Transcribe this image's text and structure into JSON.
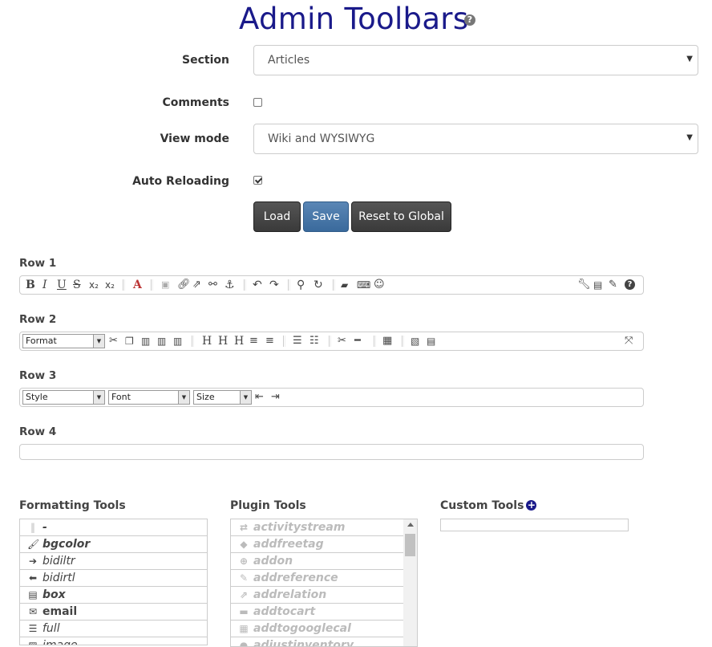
{
  "page": {
    "title": "Admin Toolbars",
    "help_glyph": "?"
  },
  "form": {
    "section_label": "Section",
    "section_value": "Articles",
    "comments_label": "Comments",
    "comments_checked": false,
    "view_mode_label": "View mode",
    "view_mode_value": "Wiki and WYSIWYG",
    "auto_reloading_label": "Auto Reloading",
    "auto_reloading_checked": true
  },
  "buttons": {
    "load": "Load",
    "save": "Save",
    "reset": "Reset to Global"
  },
  "rows": {
    "row1": "Row 1",
    "row2": "Row 2",
    "row3": "Row 3",
    "row4": "Row 4"
  },
  "row1_tools": [
    "bold-icon",
    "italic-icon",
    "underline-icon",
    "strike-icon",
    "subscript-icon",
    "superscript-icon",
    "color-icon",
    "image-icon",
    "link-icon",
    "external-link-icon",
    "unlink-icon",
    "anchor-icon",
    "undo-icon",
    "redo-icon",
    "find-icon",
    "replace-icon",
    "eraser-icon",
    "keyboard-icon",
    "smiley-icon",
    "wrench-icon",
    "save-icon",
    "pencil-icon",
    "help-icon"
  ],
  "row2": {
    "format_combo": "Format"
  },
  "row3": {
    "style_combo": "Style",
    "font_combo": "Font",
    "size_combo": "Size"
  },
  "sections": {
    "formatting": "Formatting Tools",
    "plugin": "Plugin Tools",
    "custom": "Custom Tools"
  },
  "formatting_tools": [
    {
      "name": "-",
      "icon": "separator-icon"
    },
    {
      "name": "bgcolor",
      "icon": "brush-icon"
    },
    {
      "name": "bidiltr",
      "icon": "arrow-right-icon"
    },
    {
      "name": "bidirtl",
      "icon": "arrow-left-icon"
    },
    {
      "name": "box",
      "icon": "box-icon"
    },
    {
      "name": "email",
      "icon": "envelope-icon"
    },
    {
      "name": "full",
      "icon": "align-justify-icon"
    },
    {
      "name": "image",
      "icon": "file-image-icon"
    }
  ],
  "plugin_tools": [
    {
      "name": "activitystream",
      "icon": "exchange-icon"
    },
    {
      "name": "addfreetag",
      "icon": "tag-icon"
    },
    {
      "name": "addon",
      "icon": "search-plus-icon"
    },
    {
      "name": "addreference",
      "icon": "pencil-icon"
    },
    {
      "name": "addrelation",
      "icon": "external-link-icon"
    },
    {
      "name": "addtocart",
      "icon": "cart-icon"
    },
    {
      "name": "addtogooglecal",
      "icon": "calendar-icon"
    },
    {
      "name": "adjustinventory",
      "icon": "circle-icon"
    }
  ],
  "colors": {
    "title": "#1a1a8a",
    "save_button": "#4a79ac",
    "dark_button": "#444444"
  }
}
